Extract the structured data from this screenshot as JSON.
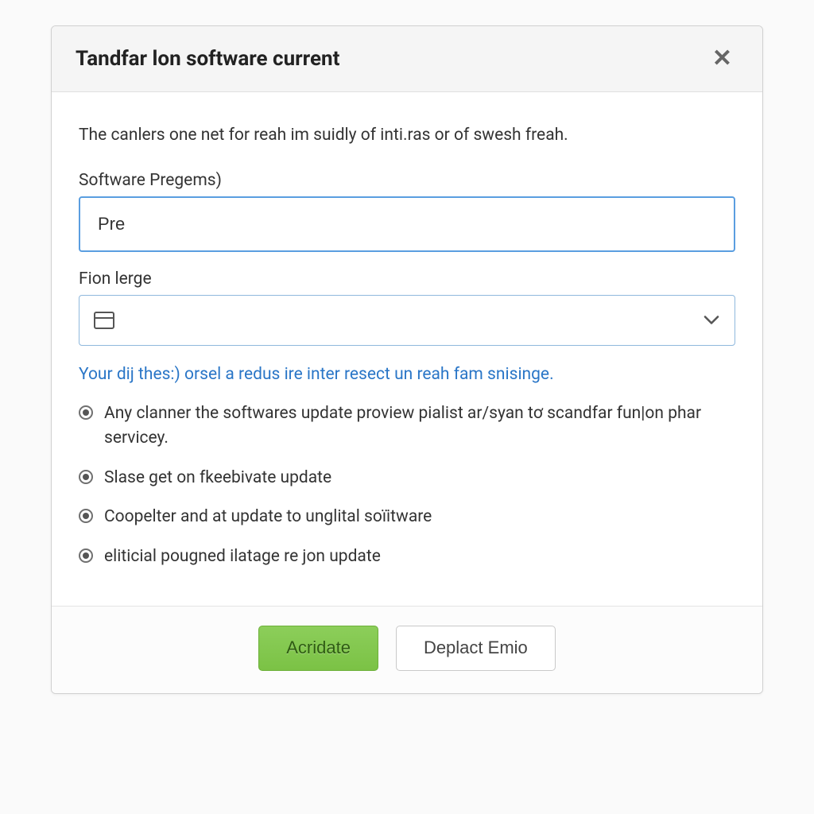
{
  "dialog": {
    "title": "Tandfar lon software current",
    "description": "The canlers one net for reah im suidly of inti.ras or of swesh freah.",
    "fields": {
      "software": {
        "label": "Software Pregems)",
        "value": "Pre"
      },
      "fion": {
        "label": "Fion lerge",
        "value": ""
      }
    },
    "help_text": "Your dij thes:) orsel a redus ire inter resect un reah fam snisinge.",
    "options": [
      "Any clanner the softwares update proview pialist ar/syan tơ scandfar fun|on phar servicey.",
      "Slase get on fkeebivate update",
      "Coopelter and at update to unglital soïitware",
      "eliticial pougned ilatage re jon update"
    ],
    "footer": {
      "primary_label": "Acridate",
      "secondary_label": "Deplact Emio"
    }
  }
}
